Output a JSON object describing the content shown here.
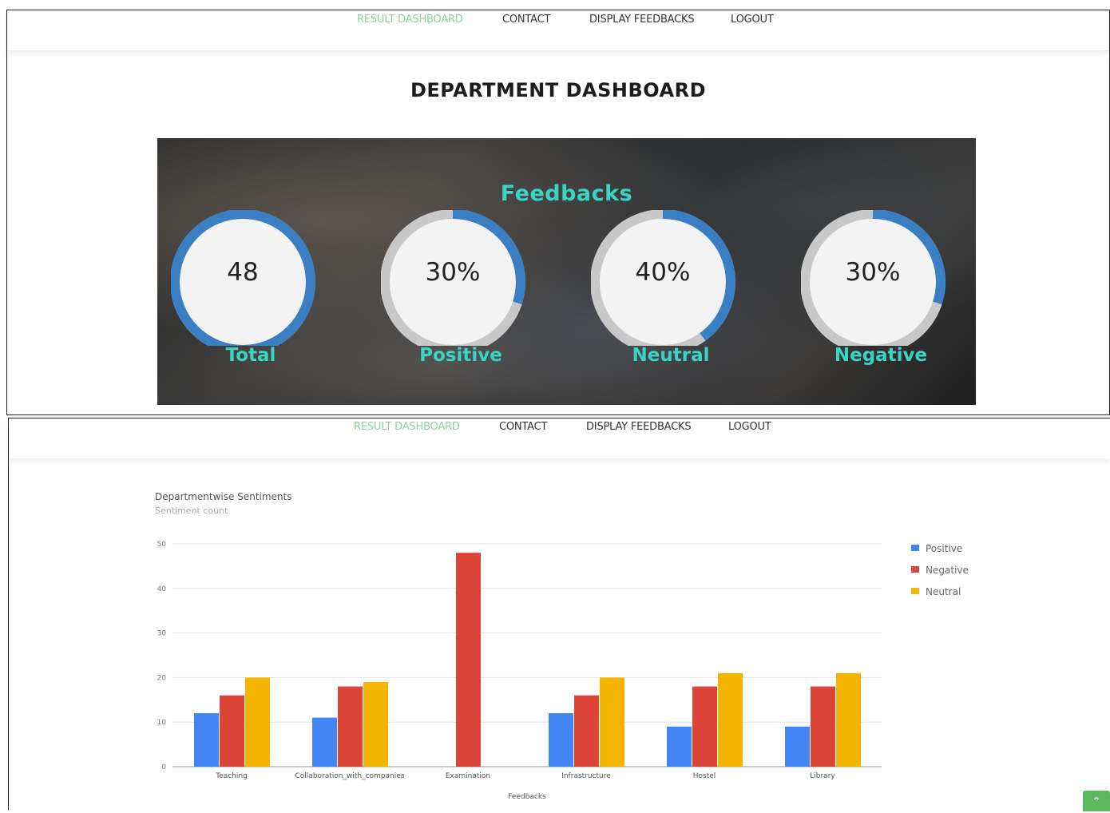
{
  "nav": {
    "items": [
      "RESULT DASHBOARD",
      "CONTACT",
      "DISPLAY FEEDBACKS",
      "LOGOUT"
    ],
    "active": "RESULT DASHBOARD"
  },
  "dashboard": {
    "title": "DEPARTMENT DASHBOARD",
    "section_title": "Feedbacks",
    "stats": [
      {
        "value": "48",
        "label": "Total",
        "fill_fraction": 1.0
      },
      {
        "value": "30%",
        "label": "Positive",
        "fill_fraction": 0.3
      },
      {
        "value": "40%",
        "label": "Neutral",
        "fill_fraction": 0.4
      },
      {
        "value": "30%",
        "label": "Negative",
        "fill_fraction": 0.3
      }
    ],
    "ring_color": "#3a7ec4",
    "ring_track_color": "#c8c8c8"
  },
  "chart_data": {
    "type": "bar",
    "title": "Departmentwise Sentiments",
    "subtitle": "Sentiment count",
    "xlabel": "Feedbacks",
    "ylabel": "",
    "ylim": [
      0,
      50
    ],
    "yticks": [
      0,
      10,
      20,
      30,
      40,
      50
    ],
    "grid": true,
    "legend_position": "right",
    "categories": [
      "Teaching",
      "Collaboration_with_companies",
      "Examination",
      "Infrastructure",
      "Hostel",
      "Library"
    ],
    "series": [
      {
        "name": "Positive",
        "color": "#4285f4",
        "values": [
          12,
          11,
          0,
          12,
          9,
          9
        ]
      },
      {
        "name": "Negative",
        "color": "#db4437",
        "values": [
          16,
          18,
          48,
          16,
          18,
          18
        ]
      },
      {
        "name": "Neutral",
        "color": "#f4b400",
        "values": [
          20,
          19,
          0,
          20,
          21,
          21
        ]
      }
    ]
  },
  "scroll_top": {
    "icon": "chevron-up-icon",
    "glyph": "⌃"
  }
}
